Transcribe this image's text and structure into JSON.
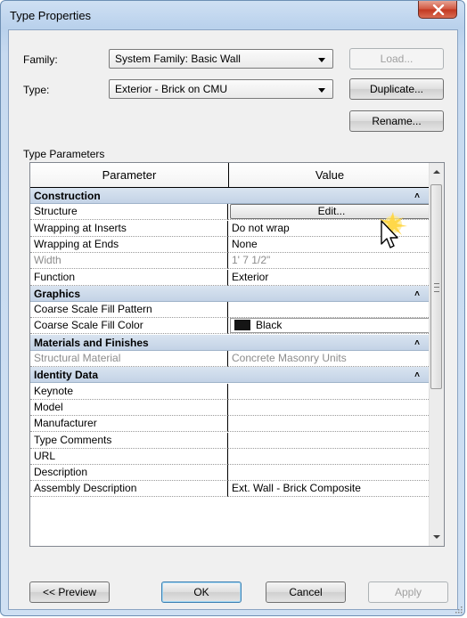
{
  "window": {
    "title": "Type Properties"
  },
  "family": {
    "label": "Family:",
    "value": "System Family: Basic Wall"
  },
  "type": {
    "label": "Type:",
    "value": "Exterior - Brick on CMU"
  },
  "buttons": {
    "load": "Load...",
    "duplicate": "Duplicate...",
    "rename": "Rename...",
    "preview": "<< Preview",
    "ok": "OK",
    "cancel": "Cancel",
    "apply": "Apply"
  },
  "type_parameters_label": "Type Parameters",
  "grid": {
    "header_parameter": "Parameter",
    "header_value": "Value",
    "rows": [
      {
        "kind": "group",
        "label": "Construction"
      },
      {
        "kind": "data",
        "param": "Structure",
        "value": "Edit..."
      },
      {
        "kind": "data",
        "param": "Wrapping at Inserts",
        "value": "Do not wrap"
      },
      {
        "kind": "data",
        "param": "Wrapping at Ends",
        "value": "None"
      },
      {
        "kind": "data",
        "param": "Width",
        "value": "1'  7 1/2\""
      },
      {
        "kind": "data",
        "param": "Function",
        "value": "Exterior"
      },
      {
        "kind": "group",
        "label": "Graphics"
      },
      {
        "kind": "data",
        "param": "Coarse Scale Fill Pattern",
        "value": ""
      },
      {
        "kind": "data",
        "param": "Coarse Scale Fill Color",
        "value": "Black"
      },
      {
        "kind": "group",
        "label": "Materials and Finishes"
      },
      {
        "kind": "data",
        "param": "Structural Material",
        "value": "Concrete Masonry Units"
      },
      {
        "kind": "group",
        "label": "Identity Data"
      },
      {
        "kind": "data",
        "param": "Keynote",
        "value": ""
      },
      {
        "kind": "data",
        "param": "Model",
        "value": ""
      },
      {
        "kind": "data",
        "param": "Manufacturer",
        "value": ""
      },
      {
        "kind": "data",
        "param": "Type Comments",
        "value": ""
      },
      {
        "kind": "data",
        "param": "URL",
        "value": ""
      },
      {
        "kind": "data",
        "param": "Description",
        "value": ""
      },
      {
        "kind": "data",
        "param": "Assembly Description",
        "value": "Ext. Wall - Brick Composite"
      }
    ]
  },
  "colors": {
    "swatch_black": "#151515",
    "group_band": "#c3d3e6",
    "title_bar": "#b9d1ec",
    "close_button": "#c2371f"
  }
}
